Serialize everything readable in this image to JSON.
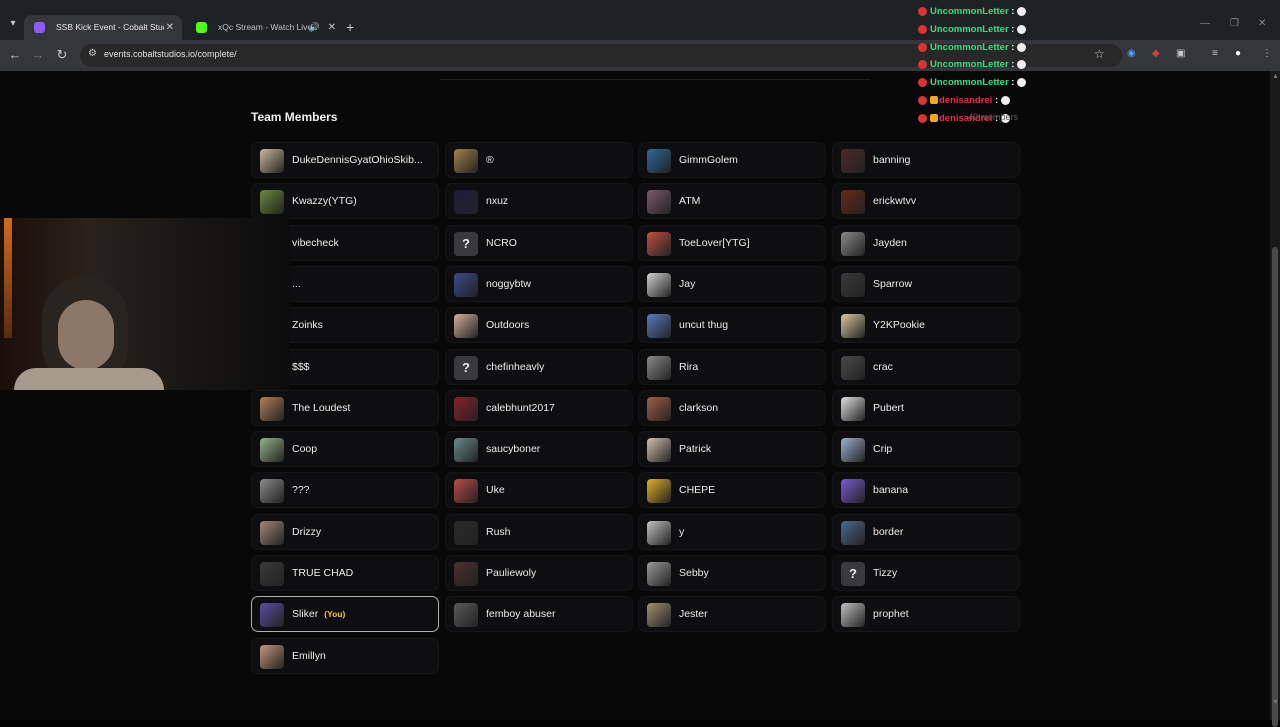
{
  "browser": {
    "tabs": [
      {
        "title": "SSB Kick Event - Cobalt Studios",
        "favicon_color": "#8b5cf6"
      },
      {
        "title": "xQc Stream - Watch Live on Kick",
        "favicon_color": "#53fc18"
      }
    ],
    "url": "events.cobaltstudios.io/complete/"
  },
  "page": {
    "heading": "Team Members",
    "you_tag": "(You)",
    "members": [
      [
        "DukeDennisGyatOhioSkibidi",
        "nxuz",
        "vibecheck",
        "...",
        "Zoinks",
        "$$$",
        "The Loudest",
        "Coop",
        "???",
        "Drizzy",
        "TRUE CHAD",
        "Sliker",
        "Emillyn"
      ],
      [
        "®",
        "nxuz"
      ],
      [],
      []
    ],
    "columns": [
      [
        {
          "name": "DukeDennisGyatOhioSkib...",
          "avatar": "#c8b8a0"
        },
        {
          "name": "Kwazzy(YTG)",
          "avatar": "#6a8a3a"
        },
        {
          "name": "vibecheck",
          "avatar": "blank"
        },
        {
          "name": "...",
          "avatar": "blank"
        },
        {
          "name": "Zoinks",
          "avatar": "blank"
        },
        {
          "name": "$$$",
          "avatar": "blank"
        },
        {
          "name": "The Loudest",
          "avatar": "#b0805a"
        },
        {
          "name": "Coop",
          "avatar": "#9ab08a"
        },
        {
          "name": "???",
          "avatar": "#8a8a8a"
        },
        {
          "name": "Drizzy",
          "avatar": "#a0887a"
        },
        {
          "name": "TRUE CHAD",
          "avatar": "#3a3a3a"
        },
        {
          "name": "Sliker",
          "avatar": "#5a4ea0",
          "you": true
        },
        {
          "name": "Emillyn",
          "avatar": "#c09880"
        }
      ],
      [
        {
          "name": "®",
          "avatar": "#a0844a"
        },
        {
          "name": "nxuz",
          "avatar": "#1c1c40"
        },
        {
          "name": "NCRO",
          "avatar": "?"
        },
        {
          "name": "noggybtw",
          "avatar": "#3a4a8a"
        },
        {
          "name": "Outdoors",
          "avatar": "#d0b0a0"
        },
        {
          "name": "chefinheavly",
          "avatar": "?"
        },
        {
          "name": "calebhunt2017",
          "avatar": "#8a2030"
        },
        {
          "name": "saucyboner",
          "avatar": "#6a8a8a"
        },
        {
          "name": "Uke",
          "avatar": "#c04a4a"
        },
        {
          "name": "Rush",
          "avatar": "#2a2a2a"
        },
        {
          "name": "Pauliewoly",
          "avatar": "#4a3030"
        },
        {
          "name": "femboy abuser",
          "avatar": "#5a5a5a"
        }
      ],
      [
        {
          "name": "GimmGolem",
          "avatar": "#2a6a9a"
        },
        {
          "name": "ATM",
          "avatar": "#7a5a6a"
        },
        {
          "name": "ToeLover[YTG]",
          "avatar": "#c05040"
        },
        {
          "name": "Jay",
          "avatar": "#d0d0d0"
        },
        {
          "name": "uncut thug",
          "avatar": "#5a7ac0"
        },
        {
          "name": "Rira",
          "avatar": "#8a8a8a"
        },
        {
          "name": "clarkson",
          "avatar": "#a06048"
        },
        {
          "name": "Patrick",
          "avatar": "#d0c0b0"
        },
        {
          "name": "CHEPE",
          "avatar": "#e0b020"
        },
        {
          "name": "y",
          "avatar": "#c0c0c0"
        },
        {
          "name": "Sebby",
          "avatar": "#9a9a9a"
        },
        {
          "name": "Jester",
          "avatar": "#a09070"
        }
      ],
      [
        {
          "name": "banning",
          "avatar": "#4a2a2a"
        },
        {
          "name": "erickwtvv",
          "avatar": "#6a2a1a"
        },
        {
          "name": "Jayden",
          "avatar": "#8a8a8a"
        },
        {
          "name": "Sparrow",
          "avatar": "#3a3a3a"
        },
        {
          "name": "Y2KPookie",
          "avatar": "#d8c8a0"
        },
        {
          "name": "crac",
          "avatar": "#4a4a4a"
        },
        {
          "name": "Pubert",
          "avatar": "#e0e0e0"
        },
        {
          "name": "Crip",
          "avatar": "#a0b0d0"
        },
        {
          "name": "banana",
          "avatar": "#7a5ad0"
        },
        {
          "name": "border",
          "avatar": "#4a6a8a"
        },
        {
          "name": "Tizzy",
          "avatar": "?"
        },
        {
          "name": "prophet",
          "avatar": "#c0c0c0"
        }
      ]
    ]
  },
  "chat": {
    "lines": [
      {
        "user": "UncommonLetter",
        "color": "#3ddc84"
      },
      {
        "user": "UncommonLetter",
        "color": "#3ddc84"
      },
      {
        "user": "UncommonLetter",
        "color": "#3ddc84"
      },
      {
        "user": "UncommonLetter",
        "color": "#3ddc84"
      },
      {
        "user": "UncommonLetter",
        "color": "#3ddc84"
      },
      {
        "user": "denisandrei",
        "color": "#e0304a",
        "badges": true
      },
      {
        "user": "denisandrei",
        "color": "#e0304a",
        "badges": true
      }
    ],
    "members_text": "49 members"
  }
}
